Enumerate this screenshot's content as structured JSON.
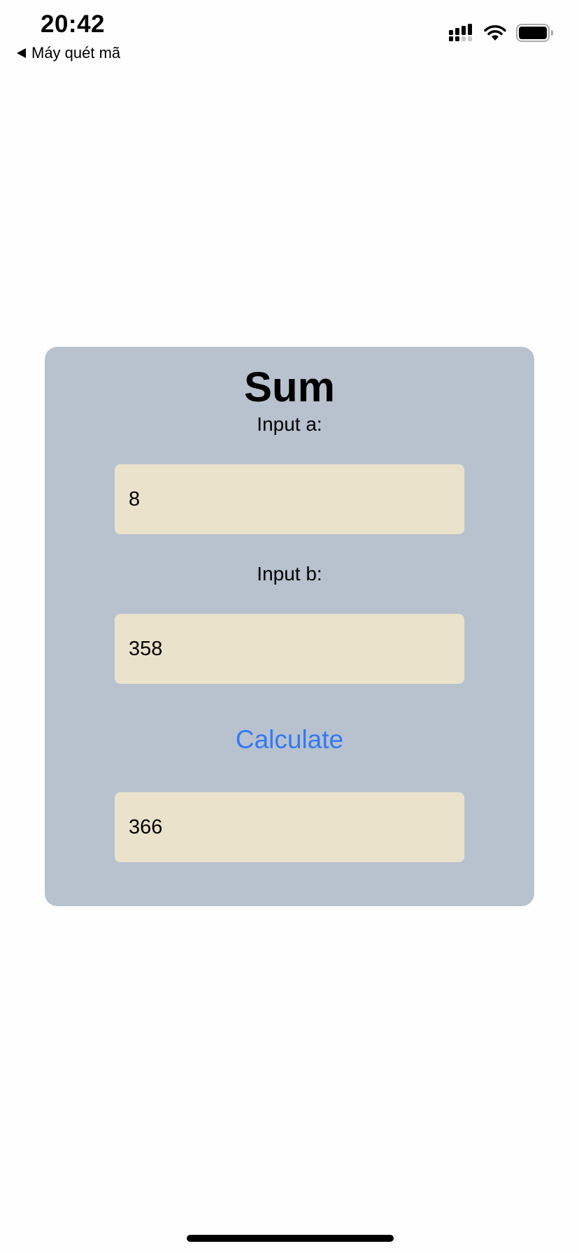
{
  "status_bar": {
    "time": "20:42",
    "back_label": "Máy quét mã",
    "icons": [
      "cellular-signal-icon",
      "wifi-icon",
      "battery-icon"
    ]
  },
  "card": {
    "title": "Sum",
    "input_a": {
      "label": "Input a:",
      "value": "8"
    },
    "input_b": {
      "label": "Input b:",
      "value": "358"
    },
    "calculate_label": "Calculate",
    "result_value": "366"
  },
  "colors": {
    "page_background": "#FEFEFE",
    "card_background": "#B8C2CE",
    "field_background": "#EAE2CA",
    "accent": "#3478F6",
    "text": "#000000"
  }
}
